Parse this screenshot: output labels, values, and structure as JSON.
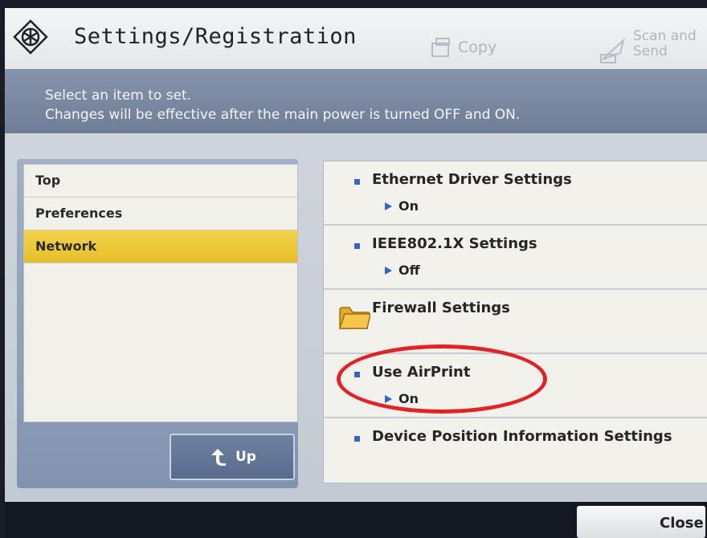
{
  "header": {
    "title": "Settings/Registration",
    "functions": [
      {
        "label": "Copy",
        "icon": "copy-icon"
      },
      {
        "label_line1": "Scan and",
        "label_line2": "Send",
        "icon": "scan-send-icon"
      }
    ],
    "icon": "settings-registration-icon"
  },
  "message": {
    "line1": "Select an item to set.",
    "line2": "Changes will be effective after the main power is turned OFF and ON."
  },
  "sidebar": {
    "items": [
      {
        "label": "Top",
        "selected": false
      },
      {
        "label": "Preferences",
        "selected": false
      },
      {
        "label": "Network",
        "selected": true
      }
    ],
    "up_button": {
      "label": "Up",
      "icon": "up-arrow-icon"
    }
  },
  "settings_list": {
    "items": [
      {
        "label": "Ethernet Driver Settings",
        "value": "On",
        "icon": "bullet"
      },
      {
        "label": "IEEE802.1X Settings",
        "value": "Off",
        "icon": "bullet"
      },
      {
        "label": "Firewall Settings",
        "icon": "folder-icon"
      },
      {
        "label": "Use AirPrint",
        "value": "On",
        "icon": "bullet"
      },
      {
        "label": "Device Position Information Settings",
        "icon": "bullet"
      }
    ]
  },
  "footer": {
    "close_label": "Close"
  },
  "colors": {
    "accent_blue": "#2f66c7",
    "selected_yellow": "#f0cc3c",
    "annotation_red": "#e12328"
  }
}
